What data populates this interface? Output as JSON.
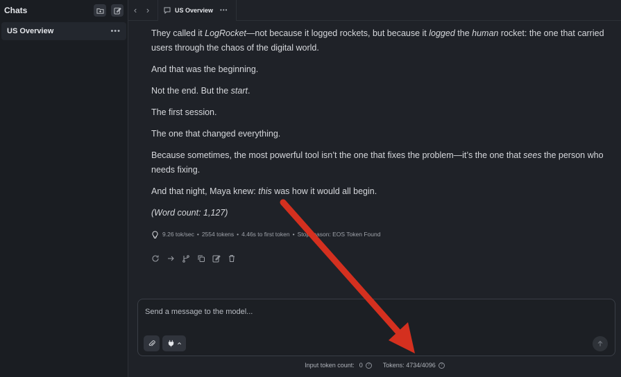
{
  "sidebar": {
    "title": "Chats",
    "chats": [
      {
        "label": "US Overview"
      }
    ]
  },
  "tab": {
    "label": "US Overview"
  },
  "messages": {
    "p1_a": "They called it ",
    "p1_b": "LogRocket",
    "p1_c": "—not because it logged rockets, but because it ",
    "p1_d": "logged",
    "p1_e": " the ",
    "p1_f": "human",
    "p1_g": " rocket: the one that carried users through the chaos of the digital world.",
    "p2": "And that was the beginning.",
    "p3_a": "Not the end. But the ",
    "p3_b": "start",
    "p3_c": ".",
    "p4": "The first session.",
    "p5": "The one that changed everything.",
    "p6_a": "Because sometimes, the most powerful tool isn’t the one that fixes the problem—it’s the one that ",
    "p6_b": "sees",
    "p6_c": " the person who needs fixing.",
    "p7_a": "And that night, Maya knew: ",
    "p7_b": "this",
    "p7_c": " was how it would all begin.",
    "p8": "(Word count: 1,127)"
  },
  "stats": {
    "speed": "9.26 tok/sec",
    "tokens": "2554 tokens",
    "first_token": "4.46s to first token",
    "stop": "Stop reason: EOS Token Found"
  },
  "input": {
    "placeholder": "Send a message to the model..."
  },
  "footer": {
    "input_count_label": "Input token count:",
    "input_count_value": "0",
    "tokens_label": "Tokens: 4734/4096"
  },
  "colors": {
    "annotation_arrow": "#d4301f"
  }
}
